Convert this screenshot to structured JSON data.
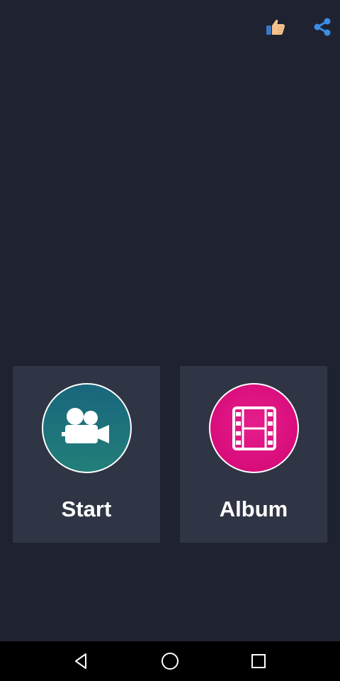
{
  "icons": {
    "like": "thumbs-up-icon",
    "share": "share-icon",
    "start": "video-camera-icon",
    "album": "film-strip-icon",
    "back": "back-triangle-icon",
    "home": "home-circle-icon",
    "recent": "recent-square-icon"
  },
  "colors": {
    "background": "#1f2331",
    "card": "#303545",
    "start_circle": "#1d7279",
    "album_circle": "#e0147f",
    "share_icon": "#3a8ee6",
    "like_icon": "#f4c08a"
  },
  "cards": {
    "start_label": "Start",
    "album_label": "Album"
  }
}
